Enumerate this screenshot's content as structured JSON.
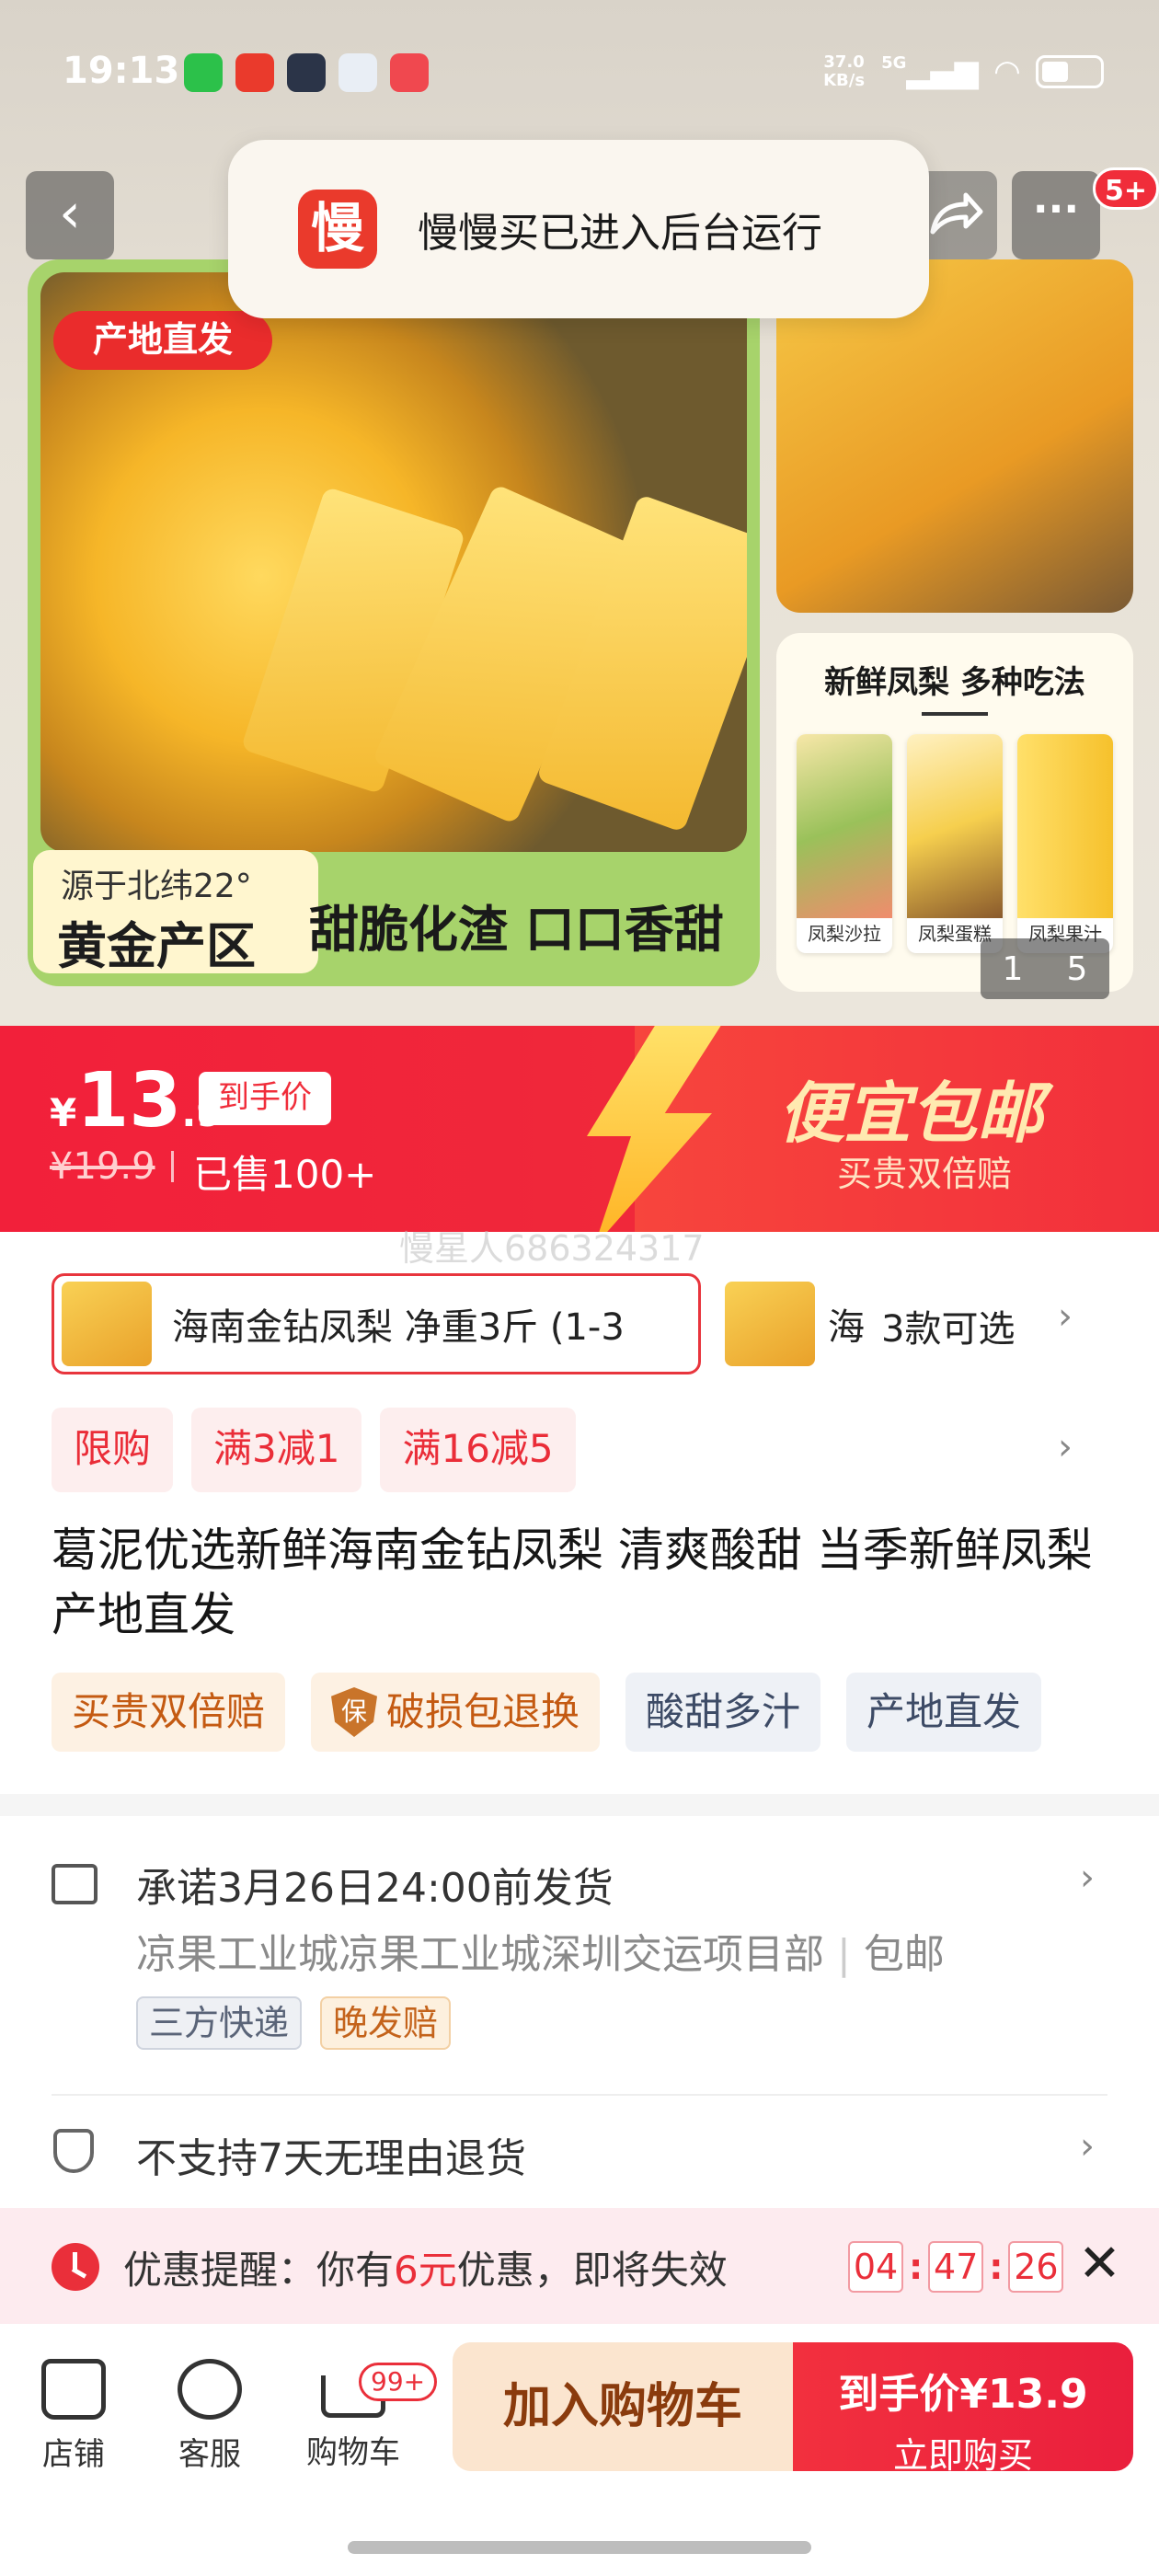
{
  "status_bar": {
    "time": "19:13",
    "net_speed_value": "37.0",
    "net_speed_unit": "KB/s",
    "signal": "5G"
  },
  "header": {
    "back_icon": "back-arrow",
    "share_icon": "share-arrow",
    "more_icon": "ellipsis",
    "more_badge": "5+"
  },
  "toast": {
    "logo_char": "慢",
    "text": "慢慢买已进入后台运行"
  },
  "gallery": {
    "origin_tag": "产地直发",
    "note_small": "源于北纬22°",
    "note_big": "黄金产区",
    "main_caption": "甜脆化渣 口口香甜",
    "side_title": "新鲜凤梨 多种吃法",
    "thumbs": [
      "凤梨沙拉",
      "凤梨蛋糕",
      "凤梨果汁"
    ],
    "pager_current": "1",
    "pager_total": "5"
  },
  "price": {
    "currency": "¥",
    "int": "13",
    "dec": ".9",
    "tag": "到手价",
    "original": "¥19.9",
    "sold": "已售100+",
    "promo_title": "便宜包邮",
    "promo_sub": "买贵双倍赔"
  },
  "watermark": "慢星人686324317",
  "sku": {
    "selected_label": "海南金钻凤梨 净重3斤 (1-3",
    "other_label": "海",
    "count_label": "3款可选"
  },
  "promo_tags": [
    "限购",
    "满3减1",
    "满16减5"
  ],
  "title": "葛泥优选新鲜海南金钻凤梨 清爽酸甜 当季新鲜凤梨产地直发",
  "attr_tags": [
    {
      "label": "买贵双倍赔",
      "style": "warm"
    },
    {
      "label": "破损包退换",
      "style": "warm",
      "icon_char": "保"
    },
    {
      "label": "酸甜多汁",
      "style": "cool"
    },
    {
      "label": "产地直发",
      "style": "cool"
    }
  ],
  "shipping": {
    "promise": "承诺3月26日24:00前发货",
    "address": "凉果工业城凉果工业城深圳交运项目部",
    "free_ship": "包邮",
    "tags": [
      "三方快递",
      "晚发赔"
    ]
  },
  "returns": {
    "text": "不支持7天无理由退货"
  },
  "reminder": {
    "prefix": "优惠提醒：你有",
    "amount": "6元",
    "suffix": "优惠，即将失效",
    "timer": [
      "04",
      "47",
      "26"
    ]
  },
  "bottom_bar": {
    "store": "店铺",
    "service": "客服",
    "cart": "购物车",
    "cart_badge": "99+",
    "add_cart": "加入购物车",
    "buy_line1": "到手价¥13.9",
    "buy_line2": "立即购买"
  },
  "colors": {
    "accent_red": "#f02d3a",
    "promo_yellow": "#ffe36b",
    "warm_tag": "#fdf1e3"
  }
}
